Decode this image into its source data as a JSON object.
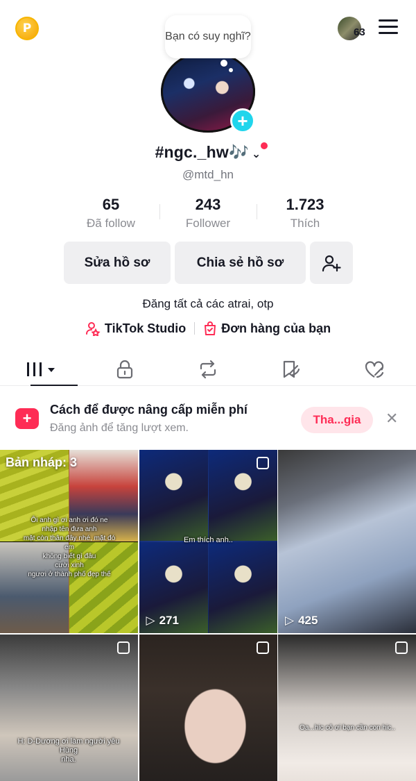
{
  "header": {
    "coin_letter": "P",
    "friend_count": "63",
    "bubble_text": "Bạn có suy nghĩ?"
  },
  "profile": {
    "username": "#ngc._hw🎶",
    "handle": "@mtd_hn",
    "stats": [
      {
        "value": "65",
        "label": "Đã follow"
      },
      {
        "value": "243",
        "label": "Follower"
      },
      {
        "value": "1.723",
        "label": "Thích"
      }
    ],
    "edit_label": "Sửa hồ sơ",
    "share_label": "Chia sẻ hồ sơ",
    "bio": "Đăng tất cả các atrai, otp",
    "links": [
      {
        "label": "TikTok Studio"
      },
      {
        "label": "Đơn hàng của bạn"
      }
    ]
  },
  "promo": {
    "title": "Cách để được nâng cấp miễn phí",
    "subtitle": "Đăng ảnh để tăng lượt xem.",
    "join_label": "Tha...gia"
  },
  "grid": [
    {
      "draft_label": "Bản nháp: 3",
      "caption": "Ôi anh gì ơi anh ơi đó ne\nnhập tên đưa anh\nmặt còn thân đây nhé, mặt đó em\nkhông biết gì đâu\ncười xinh\nngươi ở thành phố đẹp thế"
    },
    {
      "views": "271",
      "caption": "Em thích anh.."
    },
    {
      "views": "425",
      "caption": ""
    },
    {
      "caption": "H: D-Dương ơi làm người yêu Hùng\nnha."
    },
    {
      "caption": ""
    },
    {
      "caption": "Oa...hic cô ơi bạn cần con hic.."
    }
  ],
  "colors": {
    "accent": "#fe2c55",
    "teal": "#20d5ec",
    "text": "#161823",
    "muted": "#8a8b91"
  }
}
